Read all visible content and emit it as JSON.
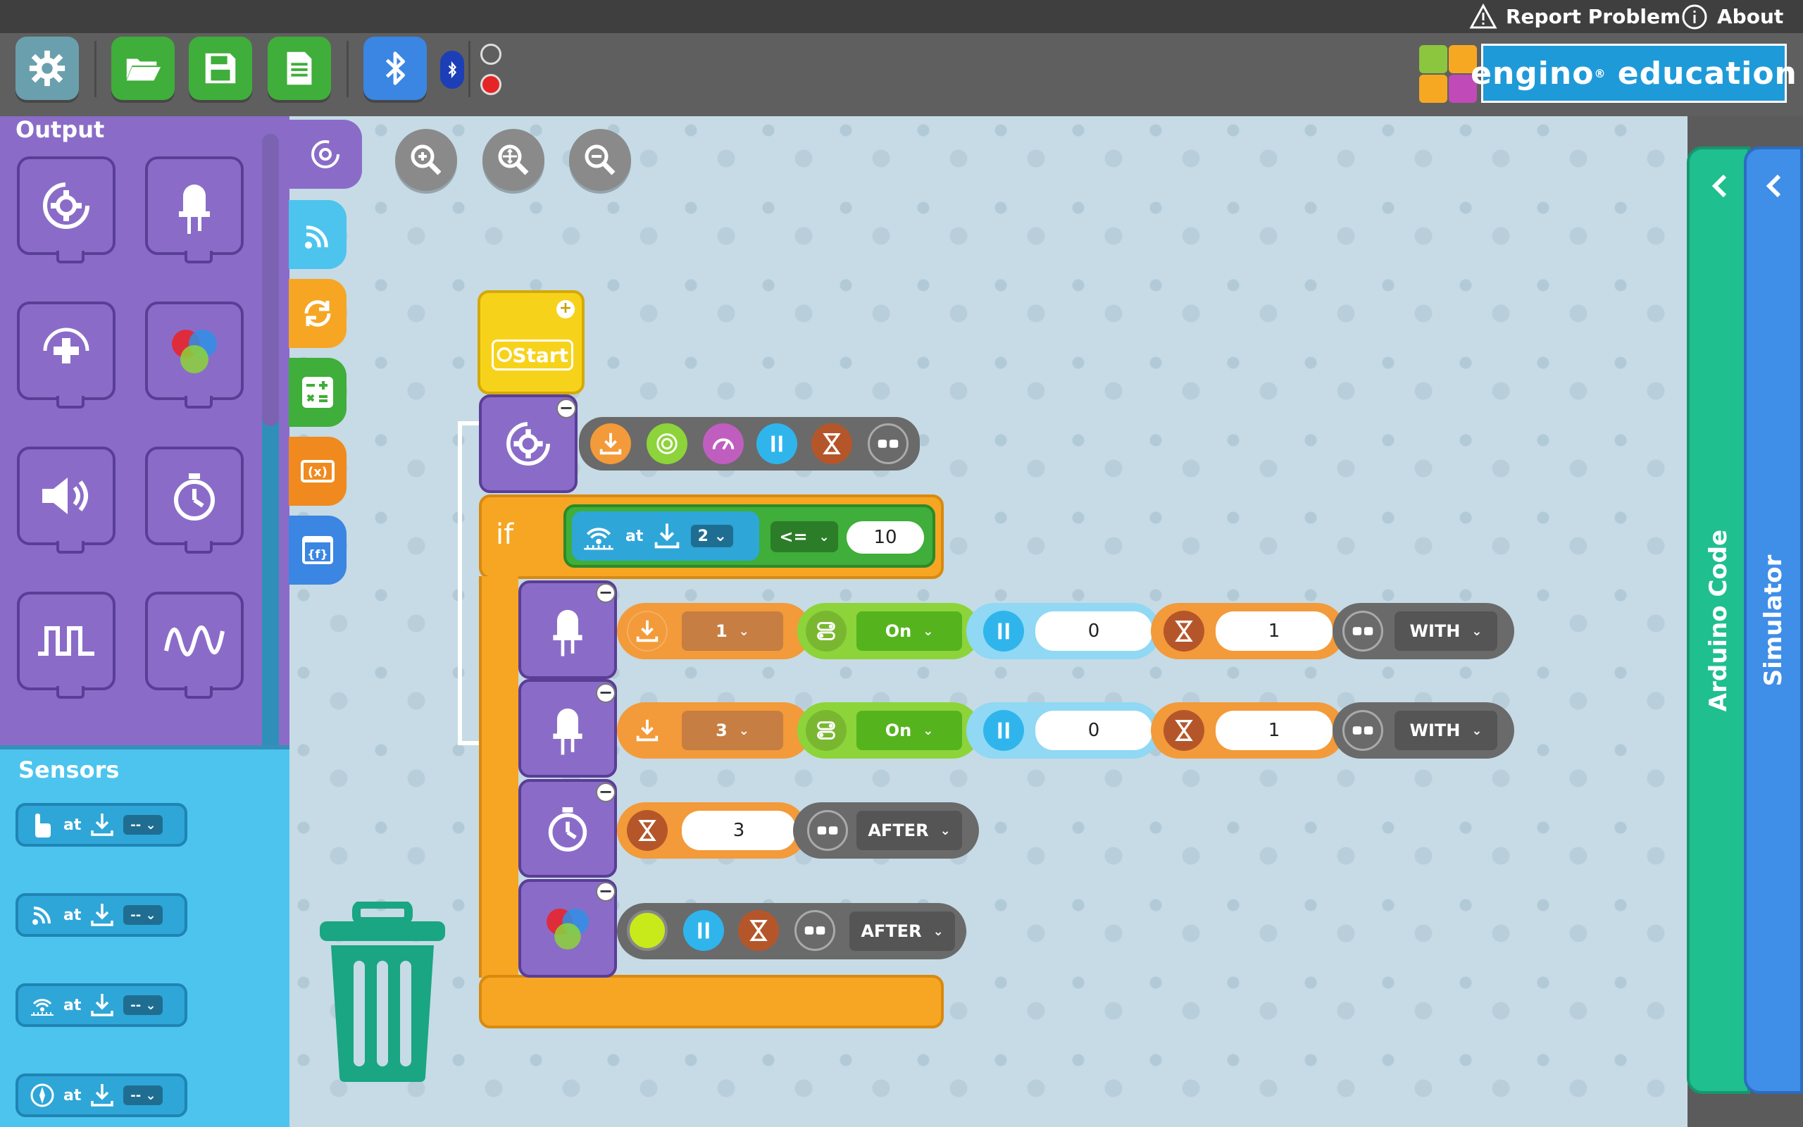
{
  "header": {
    "report_problem": "Report Problem",
    "about": "About"
  },
  "toolbar": {
    "settings_icon": "gear-icon",
    "open_icon": "folder-open-icon",
    "save_icon": "save-icon",
    "export_icon": "document-icon",
    "bluetooth_icon": "bluetooth-icon",
    "connection_status_off": "grey-dot",
    "connection_status_on": "red-dot",
    "colors": {
      "green": "#3fae3a",
      "blue": "#3a86e2",
      "grey": "#6aa0ad"
    }
  },
  "logo": {
    "text": "engino",
    "text2": "education"
  },
  "palette": {
    "output_title": "Output",
    "sensors_title": "Sensors",
    "output_blocks": [
      "motor-icon",
      "led-icon",
      "servo-icon",
      "rgb-led-icon",
      "buzzer-icon",
      "timer-icon",
      "square-wave-icon",
      "sine-wave-icon"
    ],
    "sensor_chips": [
      {
        "icon": "touch-sensor-icon",
        "at": "at",
        "value": "--"
      },
      {
        "icon": "infrared-sensor-icon",
        "at": "at",
        "value": "--"
      },
      {
        "icon": "ultrasonic-sensor-icon",
        "at": "at",
        "value": "--"
      },
      {
        "icon": "compass-sensor-icon",
        "at": "at",
        "value": "--"
      }
    ]
  },
  "categories": [
    "output-category",
    "sensors-category",
    "loops-category",
    "math-category",
    "variables-category",
    "functions-category"
  ],
  "zoom": [
    "zoom-in-icon",
    "zoom-reset-icon",
    "zoom-out-icon"
  ],
  "program": {
    "start_label": "Start",
    "if_label": "if",
    "condition": {
      "at": "at",
      "port": "2",
      "operator": "<=",
      "value": "10"
    },
    "led1": {
      "port": "1",
      "state": "On",
      "delay": "0",
      "duration": "1",
      "mode": "WITH"
    },
    "led2": {
      "port": "3",
      "state": "On",
      "delay": "0",
      "duration": "1",
      "mode": "WITH"
    },
    "timer": {
      "value": "3",
      "mode": "AFTER"
    },
    "rgb": {
      "mode": "AFTER",
      "color": "#c8ea1a"
    }
  },
  "side_panels": {
    "arduino": "Arduino Code",
    "simulator": "Simulator"
  },
  "trash_icon": "trash-icon"
}
